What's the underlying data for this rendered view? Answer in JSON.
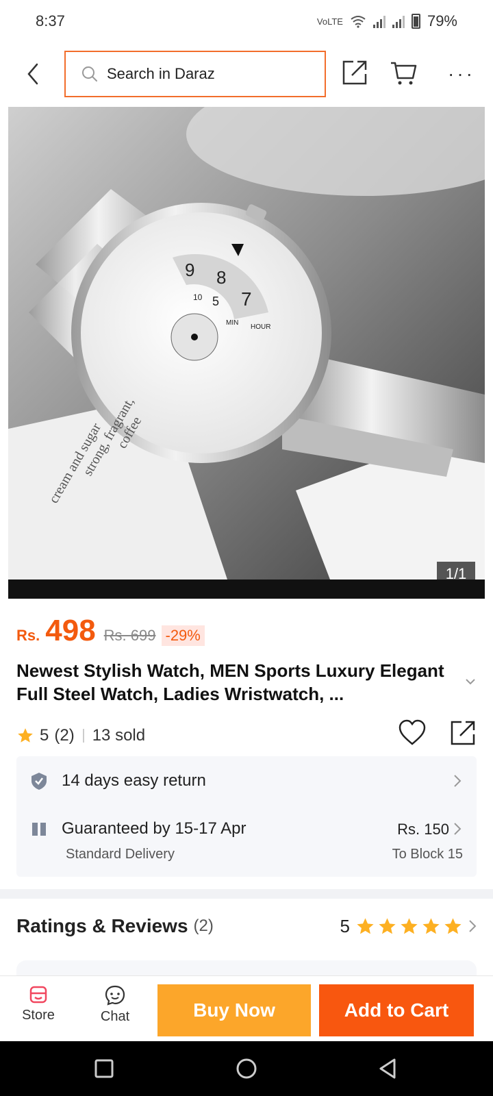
{
  "status_bar": {
    "time": "8:37",
    "network_label": "Vo) LTE2",
    "battery": "79%"
  },
  "header": {
    "search_placeholder": "Search in Daraz",
    "icons": [
      "back-icon",
      "search-icon",
      "share-icon",
      "cart-icon",
      "more-icon"
    ]
  },
  "gallery": {
    "counter": "1/1"
  },
  "product": {
    "currency": "Rs.",
    "price": "498",
    "old_price": "Rs. 699",
    "discount": "-29%",
    "title": "Newest Stylish Watch, MEN Sports Luxury Elegant Full Steel Watch, Ladies Wristwatch, ...",
    "rating": "5",
    "rating_count": "(2)",
    "sold": "13 sold"
  },
  "services": {
    "return_label": "14 days easy return",
    "delivery_label": "Guaranteed by 15-17 Apr",
    "delivery_type": "Standard Delivery",
    "delivery_fee": "Rs. 150",
    "delivery_to": "To Block 15"
  },
  "ratings": {
    "title": "Ratings & Reviews",
    "count": "(2)",
    "score": "5",
    "stars": 5
  },
  "action_bar": {
    "store_label": "Store",
    "chat_label": "Chat",
    "buy_now_label": "Buy Now",
    "add_to_cart_label": "Add to Cart"
  },
  "colors": {
    "brand_orange": "#f35a0e",
    "buy_now": "#fca62a",
    "add_to_cart": "#f8570f",
    "star": "#fdb022"
  }
}
